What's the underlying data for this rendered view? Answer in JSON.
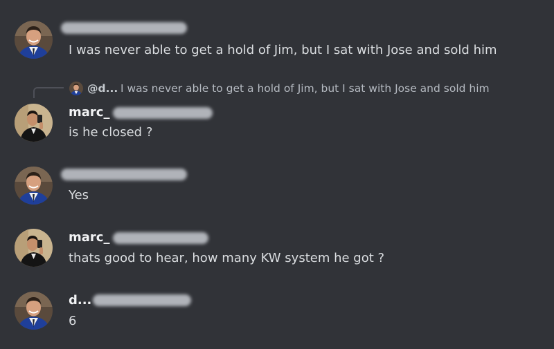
{
  "colors": {
    "background": "#313338",
    "username": "#f2f3f5",
    "message_text": "#dbdee1",
    "reply_text": "#b5bac1",
    "redaction_blur": "#b7bac0"
  },
  "messages": [
    {
      "author": "",
      "avatar_icon": "man-in-suit-avatar-icon",
      "text": "I was never able to get a hold of Jim, but I sat with Jose and sold him"
    },
    {
      "author": "marc_",
      "avatar_icon": "man-selfie-avatar-icon",
      "reply": {
        "author": "@d...",
        "text": "I was never able to get a hold of Jim, but I sat with Jose and sold him"
      },
      "text": "is he closed ?"
    },
    {
      "author": "",
      "avatar_icon": "man-in-suit-avatar-icon",
      "text": "Yes"
    },
    {
      "author": "marc_",
      "avatar_icon": "man-selfie-avatar-icon",
      "text": "thats good to hear, how many KW system he got ?"
    },
    {
      "author": "d...",
      "avatar_icon": "man-in-suit-avatar-icon",
      "text": "6"
    }
  ]
}
